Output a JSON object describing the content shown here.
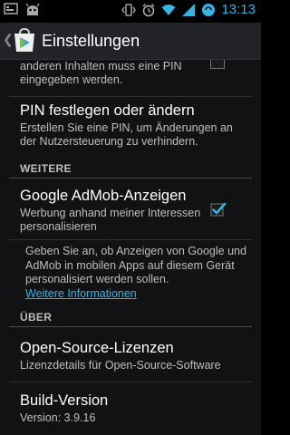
{
  "status_bar": {
    "time": "13:13",
    "icons": [
      "signal-icon",
      "android-icon",
      "vibrate-icon",
      "alarm-icon",
      "wifi-icon",
      "network-icon",
      "sync-icon"
    ]
  },
  "action_bar": {
    "title": "Einstellungen",
    "logo_icon": "play-store-icon"
  },
  "prefs": {
    "partial_summary": "anderen Inhalten muss eine PIN eingegeben werden.",
    "pin": {
      "title": "PIN festlegen oder ändern",
      "summary": "Erstellen Sie eine PIN, um Änderungen an der Nutzersteuerung zu verhindern."
    },
    "category_weitere": "WEITERE",
    "admob": {
      "title": "Google AdMob-Anzeigen",
      "summary": "Werbung anhand meiner Interessen personalisieren",
      "checked": true
    },
    "admob_info": "Geben Sie an, ob Anzeigen von Google und AdMob in mobilen Apps auf diesem Gerät personalisiert werden sollen.",
    "admob_link": "Weitere Informationen",
    "category_ueber": "ÜBER",
    "licenses": {
      "title": "Open-Source-Lizenzen",
      "summary": "Lizenzdetails für Open-Source-Software"
    },
    "build": {
      "title": "Build-Version",
      "summary": "Version: 3.9.16"
    }
  },
  "colors": {
    "accent": "#33b5e5",
    "action_bar": "#222327",
    "background": "#111214"
  }
}
